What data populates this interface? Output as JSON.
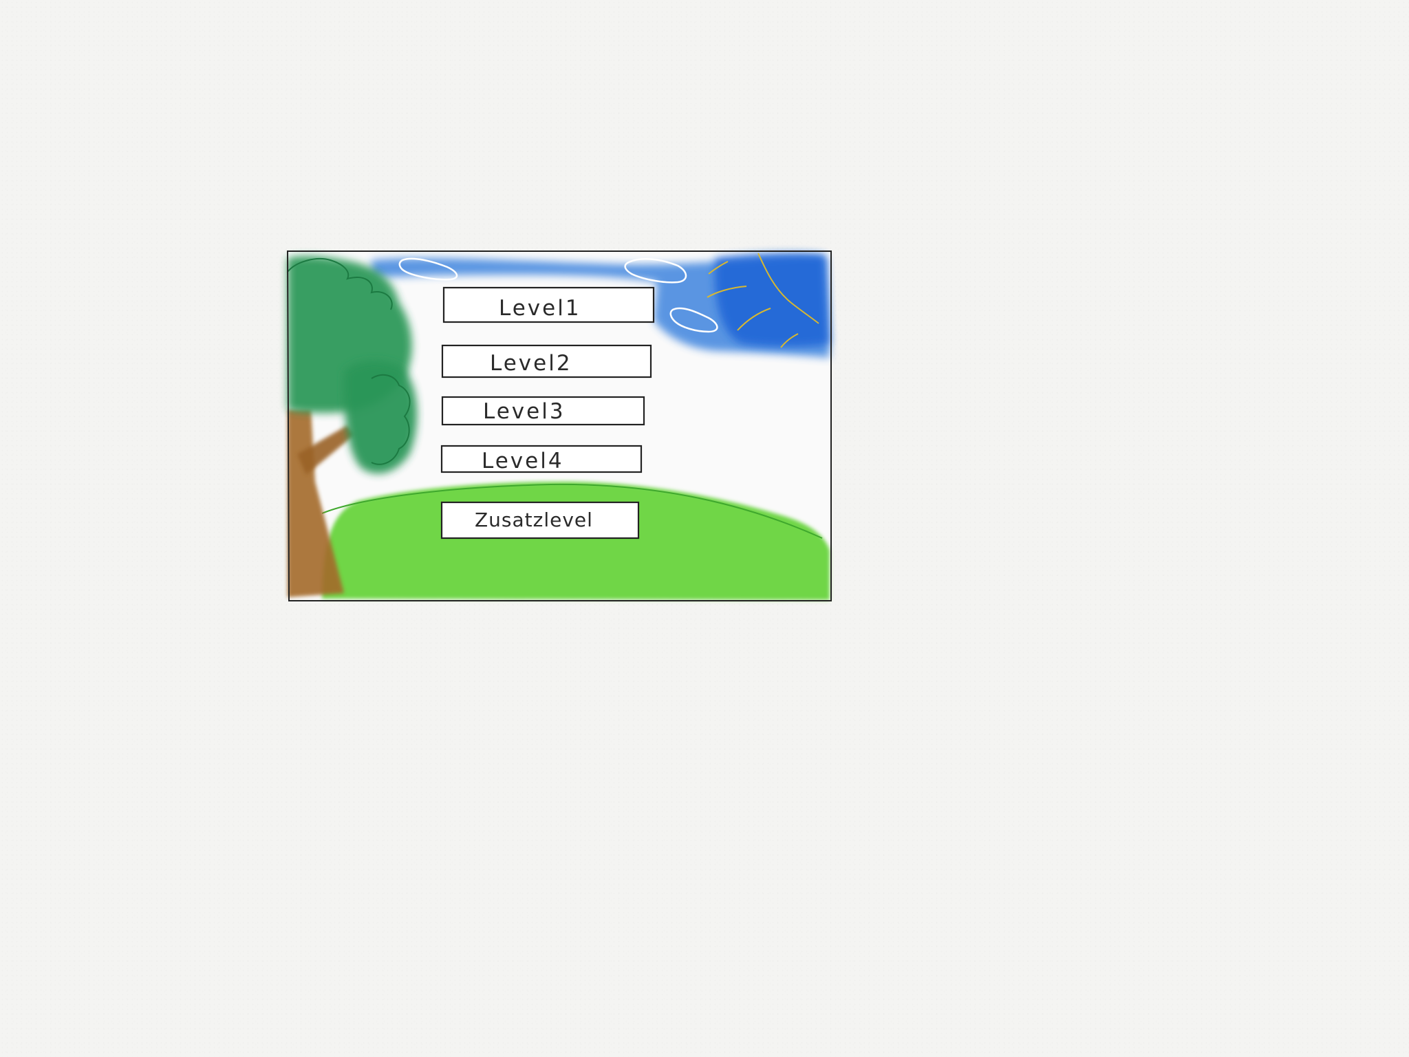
{
  "menu": {
    "buttons": [
      {
        "label": "Level1"
      },
      {
        "label": "Level2"
      },
      {
        "label": "Level3"
      },
      {
        "label": "Level4"
      },
      {
        "label": "Zusatzlevel"
      }
    ]
  },
  "colors": {
    "sky": "#3d82d6",
    "sky_dark": "#1f5fd0",
    "grass": "#6fd646",
    "tree_foliage": "#2e9a5a",
    "tree_trunk": "#a46b2b",
    "sun_rays": "#d8b830",
    "frame": "#222222"
  }
}
